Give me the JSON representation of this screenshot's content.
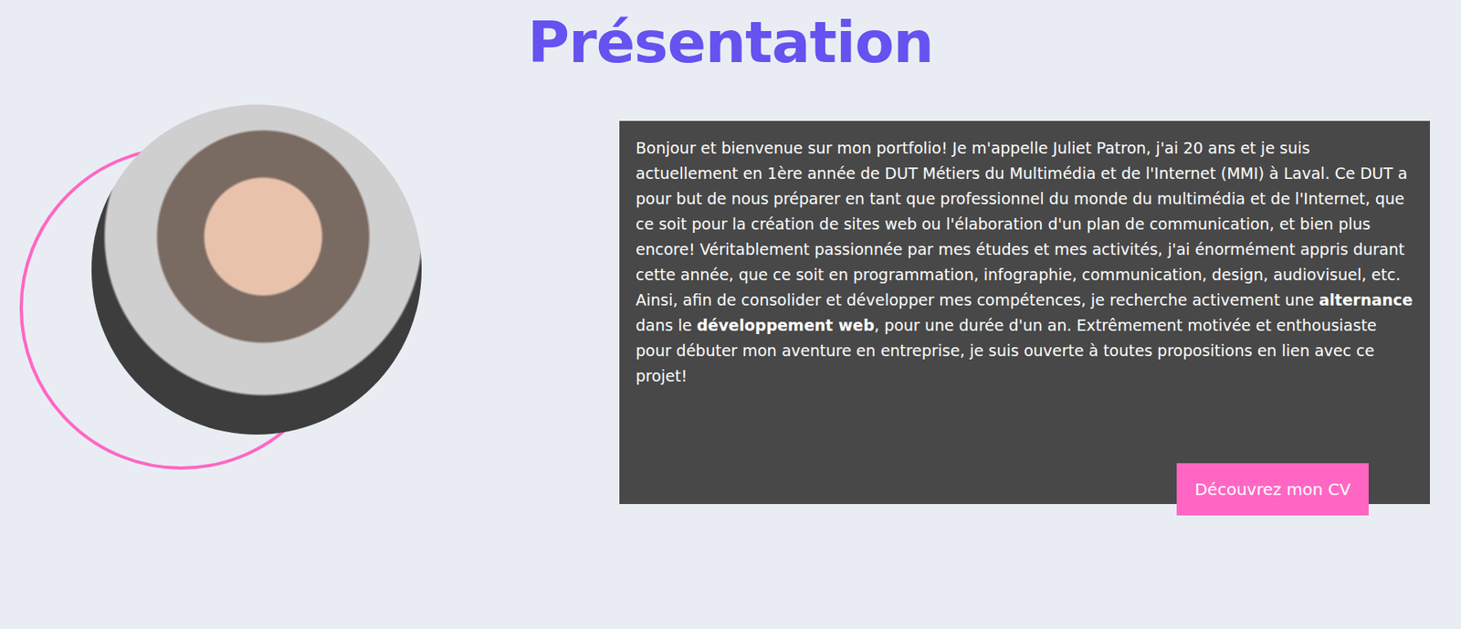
{
  "title": "Présentation",
  "intro": {
    "segments": [
      {
        "text": "Bonjour et bienvenue sur mon portfolio! Je m'appelle Juliet Patron, j'ai 20 ans et je suis actuellement en 1ère année de DUT Métiers du Multimédia et de l'Internet (MMI) à Laval. Ce DUT a pour but de nous préparer en tant que professionnel du monde du multimédia et de l'Internet, que ce soit pour la création de sites web ou l'élaboration d'un plan de communication, et bien plus encore! Véritablement passionnée par mes études et mes activités, j'ai énormément appris durant cette année, que ce soit en programmation, infographie, communication, design, audiovisuel, etc. Ainsi, afin de consolider et développer mes compétences, je recherche activement une ",
        "bold": false
      },
      {
        "text": "alternance",
        "bold": true
      },
      {
        "text": " dans le ",
        "bold": false
      },
      {
        "text": "développement web",
        "bold": true
      },
      {
        "text": ", pour une durée d'un an. Extrêmement motivée et enthousiaste pour débuter mon aventure en entreprise, je suis ouverte à toutes propositions en lien avec ce projet!",
        "bold": false
      }
    ],
    "button": "Découvrez mon CV"
  }
}
